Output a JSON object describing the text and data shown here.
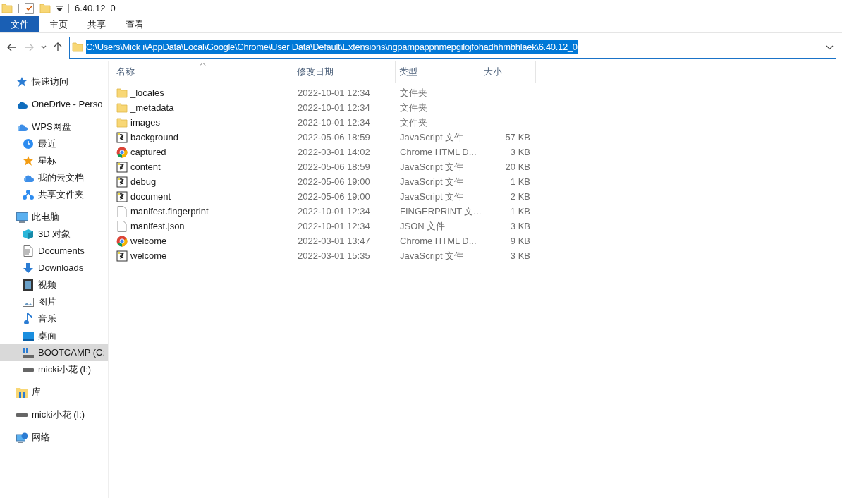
{
  "title_bar": {
    "title": "6.40.12_0"
  },
  "ribbon_tabs": [
    {
      "label": "文件",
      "selected": true
    },
    {
      "label": "主页",
      "selected": false
    },
    {
      "label": "共享",
      "selected": false
    },
    {
      "label": "查看",
      "selected": false
    }
  ],
  "address_bar": {
    "path": "C:\\Users\\Mick i\\AppData\\Local\\Google\\Chrome\\User Data\\Default\\Extensions\\ngpampappnmepgilojfohadhhmbhlaek\\6.40.12_0",
    "selected": true
  },
  "sidebar": {
    "items": [
      {
        "label": "快速访问",
        "kind": "star",
        "selected": false
      },
      {
        "label": "OneDrive - Perso",
        "kind": "cloud",
        "selected": false
      },
      {
        "label": "WPS网盘",
        "kind": "wps",
        "selected": false,
        "children": [
          {
            "label": "最近",
            "kind": "clock",
            "selected": false
          },
          {
            "label": "星标",
            "kind": "star-orange",
            "selected": false
          },
          {
            "label": "我的云文档",
            "kind": "wps",
            "selected": false
          },
          {
            "label": "共享文件夹",
            "kind": "share",
            "selected": false
          }
        ]
      },
      {
        "label": "此电脑",
        "kind": "pc",
        "selected": false,
        "children": [
          {
            "label": "3D 对象",
            "kind": "cube",
            "selected": false
          },
          {
            "label": "Documents",
            "kind": "doc",
            "selected": false
          },
          {
            "label": "Downloads",
            "kind": "download",
            "selected": false
          },
          {
            "label": "视频",
            "kind": "video",
            "selected": false
          },
          {
            "label": "图片",
            "kind": "picture",
            "selected": false
          },
          {
            "label": "音乐",
            "kind": "music",
            "selected": false
          },
          {
            "label": "桌面",
            "kind": "desktop",
            "selected": false
          },
          {
            "label": "BOOTCAMP (C:",
            "kind": "windrive",
            "selected": true
          },
          {
            "label": "micki小花 (I:)",
            "kind": "drive",
            "selected": false
          }
        ]
      },
      {
        "label": "库",
        "kind": "library",
        "selected": false
      },
      {
        "label": "micki小花 (I:)",
        "kind": "drive",
        "selected": false
      },
      {
        "label": "网络",
        "kind": "network",
        "selected": false
      }
    ]
  },
  "file_list": {
    "columns": [
      "名称",
      "修改日期",
      "类型",
      "大小"
    ],
    "rows": [
      {
        "name": "_locales",
        "date": "2022-10-01 12:34",
        "type": "文件夹",
        "size": "",
        "kind": "folder"
      },
      {
        "name": "_metadata",
        "date": "2022-10-01 12:34",
        "type": "文件夹",
        "size": "",
        "kind": "folder"
      },
      {
        "name": "images",
        "date": "2022-10-01 12:34",
        "type": "文件夹",
        "size": "",
        "kind": "folder"
      },
      {
        "name": "background",
        "date": "2022-05-06 18:59",
        "type": "JavaScript 文件",
        "size": "57 KB",
        "kind": "js"
      },
      {
        "name": "captured",
        "date": "2022-03-01 14:02",
        "type": "Chrome HTML D...",
        "size": "3 KB",
        "kind": "chrome"
      },
      {
        "name": "content",
        "date": "2022-05-06 18:59",
        "type": "JavaScript 文件",
        "size": "20 KB",
        "kind": "js"
      },
      {
        "name": "debug",
        "date": "2022-05-06 19:00",
        "type": "JavaScript 文件",
        "size": "1 KB",
        "kind": "js"
      },
      {
        "name": "document",
        "date": "2022-05-06 19:00",
        "type": "JavaScript 文件",
        "size": "2 KB",
        "kind": "js"
      },
      {
        "name": "manifest.fingerprint",
        "date": "2022-10-01 12:34",
        "type": "FINGERPRINT 文...",
        "size": "1 KB",
        "kind": "file"
      },
      {
        "name": "manifest.json",
        "date": "2022-10-01 12:34",
        "type": "JSON 文件",
        "size": "3 KB",
        "kind": "file"
      },
      {
        "name": "welcome",
        "date": "2022-03-01 13:47",
        "type": "Chrome HTML D...",
        "size": "9 KB",
        "kind": "chrome"
      },
      {
        "name": "welcome",
        "date": "2022-03-01 15:35",
        "type": "JavaScript 文件",
        "size": "3 KB",
        "kind": "js"
      }
    ]
  }
}
